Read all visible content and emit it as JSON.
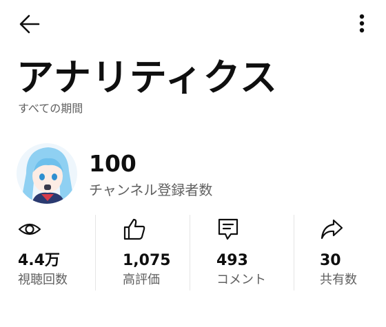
{
  "page": {
    "title": "アナリティクス",
    "period": "すべての期間"
  },
  "channel": {
    "subscriber_count": "100",
    "subscriber_label": "チャンネル登録者数"
  },
  "stats": [
    {
      "icon": "eye-icon",
      "value": "4.4万",
      "label": "視聴回数"
    },
    {
      "icon": "thumbs-up-icon",
      "value": "1,075",
      "label": "高評価"
    },
    {
      "icon": "comment-icon",
      "value": "493",
      "label": "コメント"
    },
    {
      "icon": "share-icon",
      "value": "30",
      "label": "共有数"
    }
  ],
  "colors": {
    "text_primary": "#0f0f0f",
    "text_secondary": "#606060",
    "divider": "#e5e5e5",
    "background": "#ffffff"
  }
}
